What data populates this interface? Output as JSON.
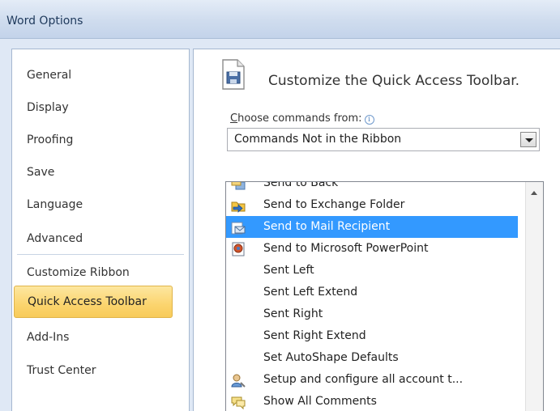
{
  "window": {
    "title": "Word Options"
  },
  "nav": {
    "items": [
      {
        "label": "General"
      },
      {
        "label": "Display"
      },
      {
        "label": "Proofing"
      },
      {
        "label": "Save"
      },
      {
        "label": "Language"
      },
      {
        "label": "Advanced"
      },
      {
        "label": "Customize Ribbon"
      },
      {
        "label": "Quick Access Toolbar",
        "selected": true
      },
      {
        "label": "Add-Ins"
      },
      {
        "label": "Trust Center"
      }
    ]
  },
  "main": {
    "heading": "Customize the Quick Access Toolbar.",
    "choose_label_access_key": "C",
    "choose_label_rest": "hoose commands from:",
    "info_icon_glyph": "i",
    "choose_value": "Commands Not in the Ribbon",
    "commands": [
      {
        "label": "Send to Back",
        "icon": "send-to-back-icon"
      },
      {
        "label": "Send to Exchange Folder",
        "icon": "exchange-folder-icon"
      },
      {
        "label": "Send to Mail Recipient",
        "icon": "mail-recipient-icon",
        "selected": true
      },
      {
        "label": "Send to Microsoft PowerPoint",
        "icon": "powerpoint-icon"
      },
      {
        "label": "Sent Left"
      },
      {
        "label": "Sent Left Extend"
      },
      {
        "label": "Sent Right"
      },
      {
        "label": "Sent Right Extend"
      },
      {
        "label": "Set AutoShape Defaults"
      },
      {
        "label": "Setup and configure all account t...",
        "icon": "account-setup-icon"
      },
      {
        "label": "Show All Comments",
        "icon": "comments-icon"
      }
    ]
  },
  "colors": {
    "selection_blue": "#3399ff",
    "nav_selected_gold": "#fbd46e",
    "title_bar_blue": "#cfdcee"
  }
}
